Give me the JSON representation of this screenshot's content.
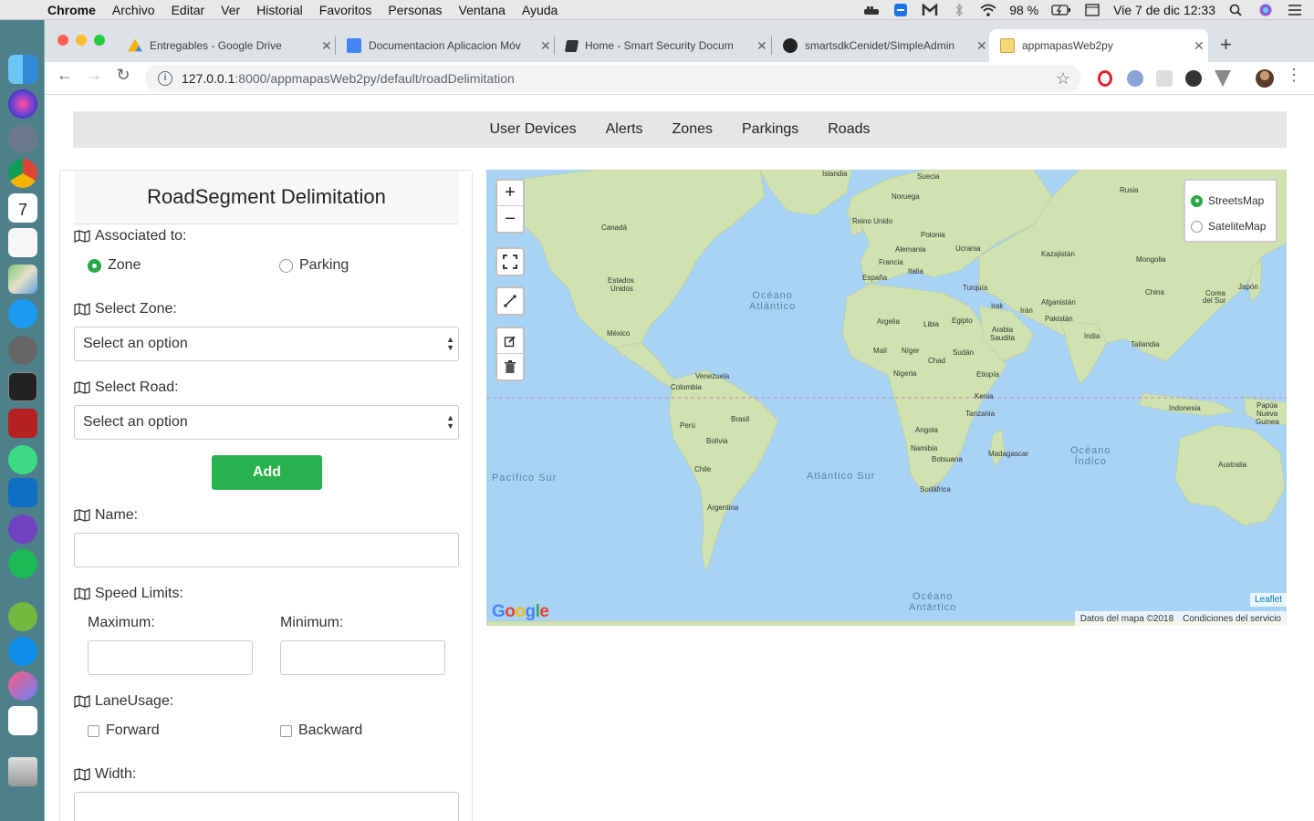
{
  "menubar": {
    "app_name": "Chrome",
    "items": [
      "Archivo",
      "Editar",
      "Ver",
      "Historial",
      "Favoritos",
      "Personas",
      "Ventana",
      "Ayuda"
    ],
    "battery": "98 %",
    "datetime": "Vie 7 de dic  12:33"
  },
  "browser": {
    "tabs": [
      {
        "title": "Entregables - Google Drive",
        "icon": "google-drive-icon"
      },
      {
        "title": "Documentacion Aplicacion Móv",
        "icon": "google-docs-icon"
      },
      {
        "title": "Home - Smart Security Docum",
        "icon": "book-icon"
      },
      {
        "title": "smartsdkCenidet/SimpleAdmin",
        "icon": "github-icon"
      },
      {
        "title": "appmapasWeb2py",
        "icon": "web2py-icon"
      }
    ],
    "url_host": "127.0.0.1",
    "url_rest": ":8000/appmapasWeb2py/default/roadDelimitation"
  },
  "navbar": {
    "links": [
      "User Devices",
      "Alerts",
      "Zones",
      "Parkings",
      "Roads"
    ]
  },
  "form": {
    "title": "RoadSegment Delimitation",
    "associated_label": "Associated to:",
    "option_zone": "Zone",
    "option_parking": "Parking",
    "select_zone_label": "Select Zone:",
    "select_zone_value": "Select an option",
    "select_road_label": "Select Road:",
    "select_road_value": "Select an option",
    "add_label": "Add",
    "name_label": "Name:",
    "speed_label": "Speed Limits:",
    "max_label": "Maximum:",
    "min_label": "Minimum:",
    "lane_label": "LaneUsage:",
    "forward_label": "Forward",
    "backward_label": "Backward",
    "width_label": "Width:"
  },
  "map": {
    "layers": [
      "StreetsMap",
      "SateliteMap"
    ],
    "selected_layer": "StreetsMap",
    "zoom_in": "+",
    "zoom_out": "−",
    "leaflet": "Leaflet",
    "attribution_data": "Datos del mapa ©2018",
    "attribution_terms": "Condiciones del servicio",
    "labels": {
      "islandia": "Islandia",
      "suecia": "Suecia",
      "rusia": "Rusia",
      "noruega": "Noruega",
      "canada": "Canadá",
      "reino_unido": "Reino Unido",
      "polonia": "Polonia",
      "alemania": "Alemania",
      "ucrania": "Ucrania",
      "kazajistan": "Kazajistán",
      "francia": "Francia",
      "mongolia": "Mongolia",
      "espana": "España",
      "italia": "Italia",
      "estados_unidos_1": "Estados",
      "estados_unidos_2": "Unidos",
      "turquia": "Turquía",
      "china": "China",
      "corea_1": "Corea",
      "corea_2": "del Sur",
      "japon": "Japón",
      "irak": "Irak",
      "iran": "Irán",
      "afganistan": "Afganistán",
      "pakistan": "Pakistán",
      "argelia": "Argelia",
      "libia": "Libia",
      "egipto": "Egipto",
      "arabia_1": "Arabia",
      "arabia_2": "Saudita",
      "india": "India",
      "mexico": "México",
      "tailandia": "Tailandia",
      "mali": "Malí",
      "niger": "Níger",
      "chad": "Chad",
      "sudan": "Sudán",
      "nigeria": "Nigeria",
      "etiopia": "Etiopía",
      "venezuela": "Venezuela",
      "colombia": "Colombia",
      "kenia": "Kenia",
      "tanzania": "Tanzania",
      "indonesia": "Indonesia",
      "papua_1": "Papúa",
      "papua_2": "Nueva",
      "papua_3": "Guinea",
      "peru": "Perú",
      "brasil": "Brasil",
      "bolivia": "Bolivia",
      "angola": "Angola",
      "namibia": "Namibia",
      "botsuana": "Botsuana",
      "madagascar": "Madagascar",
      "chile": "Chile",
      "australia": "Australia",
      "sudafrica": "Sudáfrica",
      "argentina": "Argentina"
    },
    "oceans": {
      "atlantico_1": "Océano",
      "atlantico_2": "Atlántico",
      "pacifico_sur": "Pacífico Sur",
      "atlantico_sur": "Atlántico Sur",
      "indico_1": "Océano",
      "indico_2": "Índico",
      "antartico_1": "Océano",
      "antartico_2": "Antártico"
    }
  }
}
